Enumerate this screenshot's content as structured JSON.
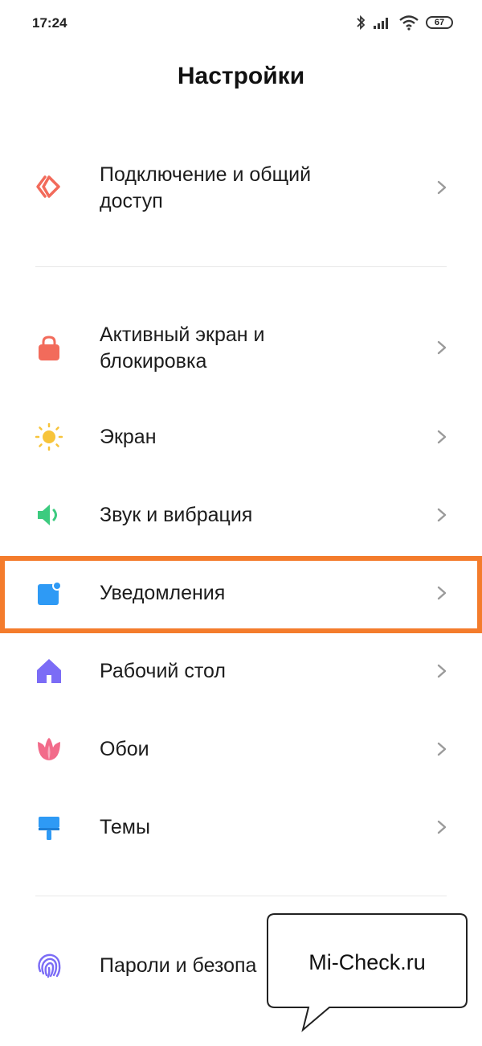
{
  "status_bar": {
    "time": "17:24",
    "battery": "67",
    "icons": [
      "bluetooth-icon",
      "signal-icon",
      "wifi-icon",
      "battery-icon"
    ]
  },
  "header": {
    "title": "Настройки"
  },
  "items": [
    {
      "label": "Подключение и общий доступ",
      "icon": "connection-share-icon",
      "color": "#F26B5B"
    },
    {
      "label": "Активный экран и блокировка",
      "icon": "lock-icon",
      "color": "#F26B5B"
    },
    {
      "label": "Экран",
      "icon": "sun-icon",
      "color": "#F7C43B"
    },
    {
      "label": "Звук и вибрация",
      "icon": "speaker-icon",
      "color": "#3CCB7F"
    },
    {
      "label": "Уведомления",
      "icon": "notification-icon",
      "color": "#2E9AF5"
    },
    {
      "label": "Рабочий стол",
      "icon": "home-icon",
      "color": "#7B6CF6"
    },
    {
      "label": "Обои",
      "icon": "tulip-icon",
      "color": "#F26B8A"
    },
    {
      "label": "Темы",
      "icon": "paint-roller-icon",
      "color": "#2E9AF5"
    },
    {
      "label": "Пароли и безопа",
      "icon": "fingerprint-icon",
      "color": "#7B6CF6"
    }
  ],
  "highlight": {
    "color": "#F47C2C",
    "target": "Уведомления"
  },
  "watermark": {
    "text": "Mi-Check.ru"
  }
}
